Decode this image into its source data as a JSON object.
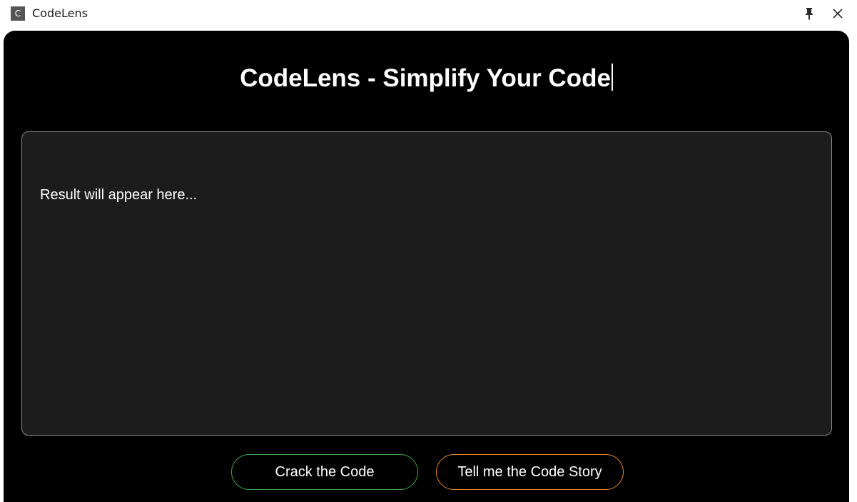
{
  "window": {
    "app_icon_letter": "C",
    "title": "CodeLens",
    "pin_icon": "pin-icon",
    "close_icon": "close-icon"
  },
  "main": {
    "title": "CodeLens - Simplify Your Code",
    "result_placeholder": "Result will appear here..."
  },
  "actions": {
    "crack_label": "Crack the Code",
    "story_label": "Tell me the Code Story"
  },
  "colors": {
    "background": "#000000",
    "panel": "#1c1c1c",
    "crack_border": "#3fa34d",
    "story_border": "#e8862a"
  }
}
